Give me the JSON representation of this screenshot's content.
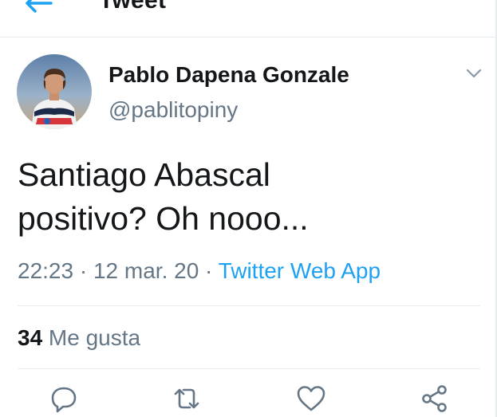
{
  "header": {
    "title": "Tweet",
    "back_icon": "arrow-left-icon"
  },
  "author": {
    "name": "Pablo Dapena Gonzale",
    "handle": "@pablitopiny",
    "avatar_icon": "user-avatar-photo",
    "menu_icon": "chevron-down-icon"
  },
  "tweet": {
    "line1": "Santiago Abascal",
    "line2": "positivo? Oh nooo..."
  },
  "meta": {
    "time": "22:23",
    "sep1": " · ",
    "date": "12 mar. 20",
    "sep2": " · ",
    "source": "Twitter Web App"
  },
  "stats": {
    "likes_count": "34",
    "likes_label": " Me gusta"
  },
  "actions": [
    {
      "name": "reply",
      "icon": "reply-icon"
    },
    {
      "name": "retweet",
      "icon": "retweet-icon"
    },
    {
      "name": "like",
      "icon": "heart-icon"
    },
    {
      "name": "share",
      "icon": "share-icon"
    }
  ],
  "colors": {
    "accent": "#1da1f2",
    "text": "#14171a",
    "secondary": "#657786",
    "divider": "#e6ecf0"
  }
}
